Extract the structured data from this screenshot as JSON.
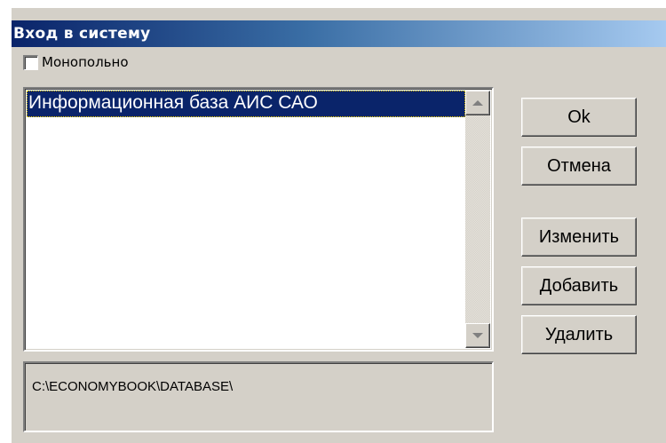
{
  "window": {
    "title": "Вход в систему"
  },
  "options": {
    "exclusive_label": "Монопольно",
    "exclusive_checked": false
  },
  "databases": {
    "items": [
      {
        "label": "Информационная база АИС САО",
        "selected": true
      }
    ]
  },
  "path": {
    "value": "C:\\ECONOMYBOOK\\DATABASE\\"
  },
  "buttons": {
    "ok": "Ok",
    "cancel": "Отмена",
    "edit": "Изменить",
    "add": "Добавить",
    "delete": "Удалить"
  },
  "icons": {
    "scroll_up": "triangle-up-icon",
    "scroll_down": "triangle-down-icon"
  },
  "colors": {
    "title_start": "#0a246a",
    "title_end": "#a6caf0",
    "selection": "#0a246a",
    "face": "#d4d0c8"
  }
}
